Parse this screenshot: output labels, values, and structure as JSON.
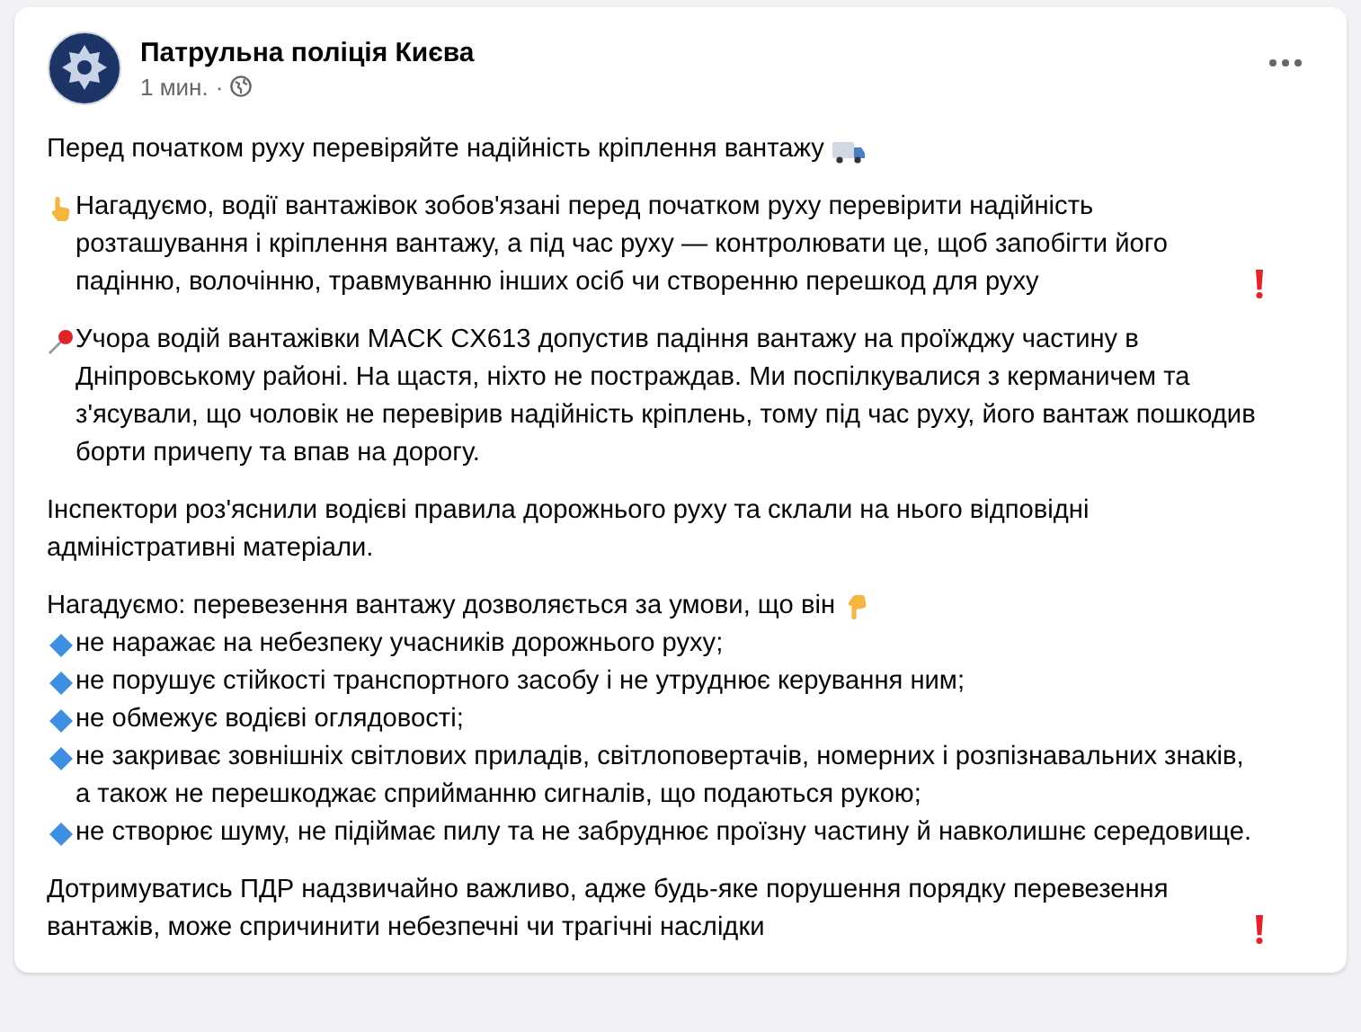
{
  "post": {
    "author": "Патрульна поліція Києва",
    "time": "1 мин.",
    "separator": "·",
    "paragraphs": [
      {
        "lines": [
          {
            "kind": "title",
            "text": "Перед початком руху перевіряйте надійність кріплення вантажу"
          }
        ]
      },
      {
        "lines": [
          {
            "kind": "pointer",
            "text": "Нагадуємо, водії вантажівок зобов'язані перед початком руху перевірити надійність розташування і кріплення вантажу, а під час руху — контролювати це, щоб запобігти його падінню, волочінню, травмуванню інших осіб чи створенню перешкод для руху"
          }
        ]
      },
      {
        "lines": [
          {
            "kind": "pin",
            "text": "Учора водій вантажівки MACK CX613 допустив падіння вантажу на проїжджу частину в Дніпровському районі. На щастя, ніхто не постраждав. Ми поспілкувалися з керманичем та з'ясували, що чоловік не перевірив надійність кріплень, тому під час руху, його вантаж пошкодив борти причепу та впав на дорогу."
          }
        ]
      },
      {
        "lines": [
          {
            "kind": "plain",
            "text": "Інспектори роз'яснили водієві правила дорожнього руху та склали на нього відповідні адміністративні матеріали."
          }
        ]
      },
      {
        "lines": [
          {
            "kind": "intro",
            "text": "Нагадуємо: перевезення вантажу дозволяється за умови, що він"
          },
          {
            "kind": "bullet",
            "text": "не наражає на небезпеку учасників дорожнього руху;"
          },
          {
            "kind": "bullet",
            "text": "не порушує стійкості транспортного засобу і не утруднює керування ним;"
          },
          {
            "kind": "bullet",
            "text": "не обмежує водієві оглядовості;"
          },
          {
            "kind": "bullet",
            "text": "не закриває зовнішніх світлових приладів, світлоповертачів, номерних і розпізнавальних знаків, а також не перешкоджає сприйманню сигналів, що подаються рукою;"
          },
          {
            "kind": "bullet",
            "text": "не створює шуму, не підіймає пилу та не забруднює проїзну частину й навколишнє середовище."
          }
        ]
      },
      {
        "lines": [
          {
            "kind": "warning",
            "text": "Дотримуватись ПДР надзвичайно важливо, адже будь-яке порушення порядку перевезення вантажів, може спричинити небезпечні чи трагічні наслідки"
          }
        ]
      }
    ]
  }
}
